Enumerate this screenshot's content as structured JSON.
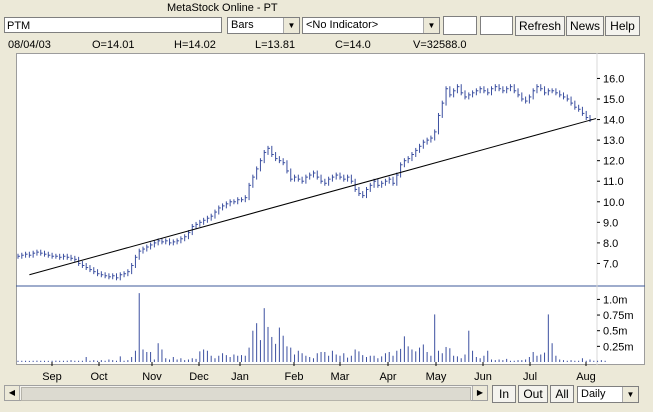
{
  "window": {
    "title": "MetaStock Online - PT"
  },
  "toolbar": {
    "symbol": "PTM",
    "chart_style": "Bars",
    "indicator": "<No Indicator>",
    "refresh_label": "Refresh",
    "news_label": "News",
    "help_label": "Help"
  },
  "ohlc": {
    "date": "08/04/03",
    "open": "O=14.01",
    "high": "H=14.02",
    "low": "L=13.81",
    "close": "C=14.0",
    "volume": "V=32588.0"
  },
  "bottom": {
    "in_label": "In",
    "out_label": "Out",
    "all_label": "All",
    "period": "Daily"
  },
  "chart_data": {
    "type": "bar",
    "x_labels": [
      "Sep",
      "Oct",
      "Nov",
      "Dec",
      "Jan",
      "Feb",
      "Mar",
      "Apr",
      "May",
      "Jun",
      "Jul",
      "Aug"
    ],
    "price_axis": {
      "ticks": [
        "7.0",
        "8.0",
        "9.0",
        "10.0",
        "11.0",
        "12.0",
        "13.0",
        "14.0",
        "15.0",
        "16.0"
      ],
      "ylim": [
        6.0,
        16.8
      ]
    },
    "volume_axis": {
      "ticks": [
        "0.25m",
        "0.5m",
        "0.75m",
        "1.0m"
      ],
      "ylim": [
        0,
        1150000
      ]
    },
    "price_series": [
      7.35,
      7.4,
      7.45,
      7.4,
      7.5,
      7.55,
      7.5,
      7.45,
      7.4,
      7.35,
      7.35,
      7.3,
      7.35,
      7.3,
      7.25,
      7.2,
      7.0,
      6.9,
      6.8,
      6.7,
      6.6,
      6.5,
      6.45,
      6.4,
      6.35,
      6.4,
      6.3,
      6.45,
      6.5,
      6.6,
      6.9,
      7.3,
      7.6,
      7.7,
      7.8,
      7.9,
      8.0,
      8.1,
      8.05,
      8.1,
      8.0,
      8.05,
      8.1,
      8.2,
      8.3,
      8.5,
      8.8,
      8.9,
      9.0,
      9.1,
      9.2,
      9.3,
      9.5,
      9.7,
      9.8,
      9.9,
      10.0,
      10.0,
      10.1,
      10.1,
      10.2,
      10.8,
      11.2,
      11.6,
      12.0,
      12.4,
      12.6,
      12.3,
      12.1,
      12.0,
      11.9,
      11.5,
      11.1,
      11.2,
      11.1,
      11.0,
      11.2,
      11.3,
      11.4,
      11.2,
      11.0,
      10.9,
      11.1,
      11.2,
      11.3,
      11.2,
      11.1,
      11.2,
      11.0,
      10.6,
      10.4,
      10.3,
      10.6,
      10.8,
      11.0,
      10.8,
      10.9,
      11.0,
      11.1,
      10.9,
      11.3,
      11.8,
      12.0,
      12.1,
      12.3,
      12.5,
      12.7,
      12.9,
      13.0,
      13.1,
      13.4,
      14.2,
      14.8,
      15.5,
      15.2,
      15.4,
      15.6,
      15.3,
      15.1,
      15.2,
      15.3,
      15.4,
      15.5,
      15.4,
      15.3,
      15.5,
      15.6,
      15.5,
      15.4,
      15.5,
      15.6,
      15.4,
      15.2,
      15.0,
      14.9,
      15.1,
      15.4,
      15.6,
      15.5,
      15.3,
      15.4,
      15.4,
      15.3,
      15.2,
      15.1,
      15.0,
      14.8,
      14.6,
      14.5,
      14.3,
      14.1,
      14.0
    ],
    "volume_series": [
      20000,
      20000,
      20000,
      18000,
      20000,
      22000,
      20000,
      20000,
      19000,
      20000,
      22000,
      20000,
      20000,
      21000,
      30000,
      20000,
      20000,
      20000,
      80000,
      20000,
      30000,
      20000,
      30000,
      20000,
      40000,
      30000,
      20000,
      90000,
      20000,
      30000,
      80000,
      180000,
      1100000,
      200000,
      160000,
      160000,
      40000,
      300000,
      200000,
      60000,
      40000,
      80000,
      40000,
      60000,
      30000,
      40000,
      60000,
      50000,
      170000,
      200000,
      180000,
      100000,
      60000,
      100000,
      140000,
      110000,
      80000,
      120000,
      100000,
      110000,
      100000,
      230000,
      500000,
      620000,
      350000,
      860000,
      560000,
      400000,
      290000,
      550000,
      420000,
      250000,
      230000,
      120000,
      180000,
      140000,
      100000,
      80000,
      60000,
      140000,
      160000,
      160000,
      100000,
      180000,
      120000,
      100000,
      140000,
      70000,
      100000,
      200000,
      170000,
      110000,
      80000,
      100000,
      100000,
      60000,
      90000,
      140000,
      160000,
      100000,
      180000,
      210000,
      410000,
      250000,
      200000,
      170000,
      230000,
      280000,
      160000,
      100000,
      760000,
      180000,
      140000,
      240000,
      220000,
      100000,
      90000,
      60000,
      120000,
      500000,
      180000,
      80000,
      60000,
      100000,
      180000,
      40000,
      30000,
      40000,
      30000,
      50000,
      20000,
      20000,
      30000,
      30000,
      40000,
      80000,
      160000,
      100000,
      120000,
      150000,
      760000,
      300000,
      100000,
      40000,
      30000,
      20000,
      30000,
      20000,
      20000,
      60000,
      20000,
      40000,
      20000,
      20000,
      30000,
      20000
    ],
    "trendline": {
      "start": [
        3,
        6.45
      ],
      "end": [
        151,
        14.0
      ]
    }
  }
}
